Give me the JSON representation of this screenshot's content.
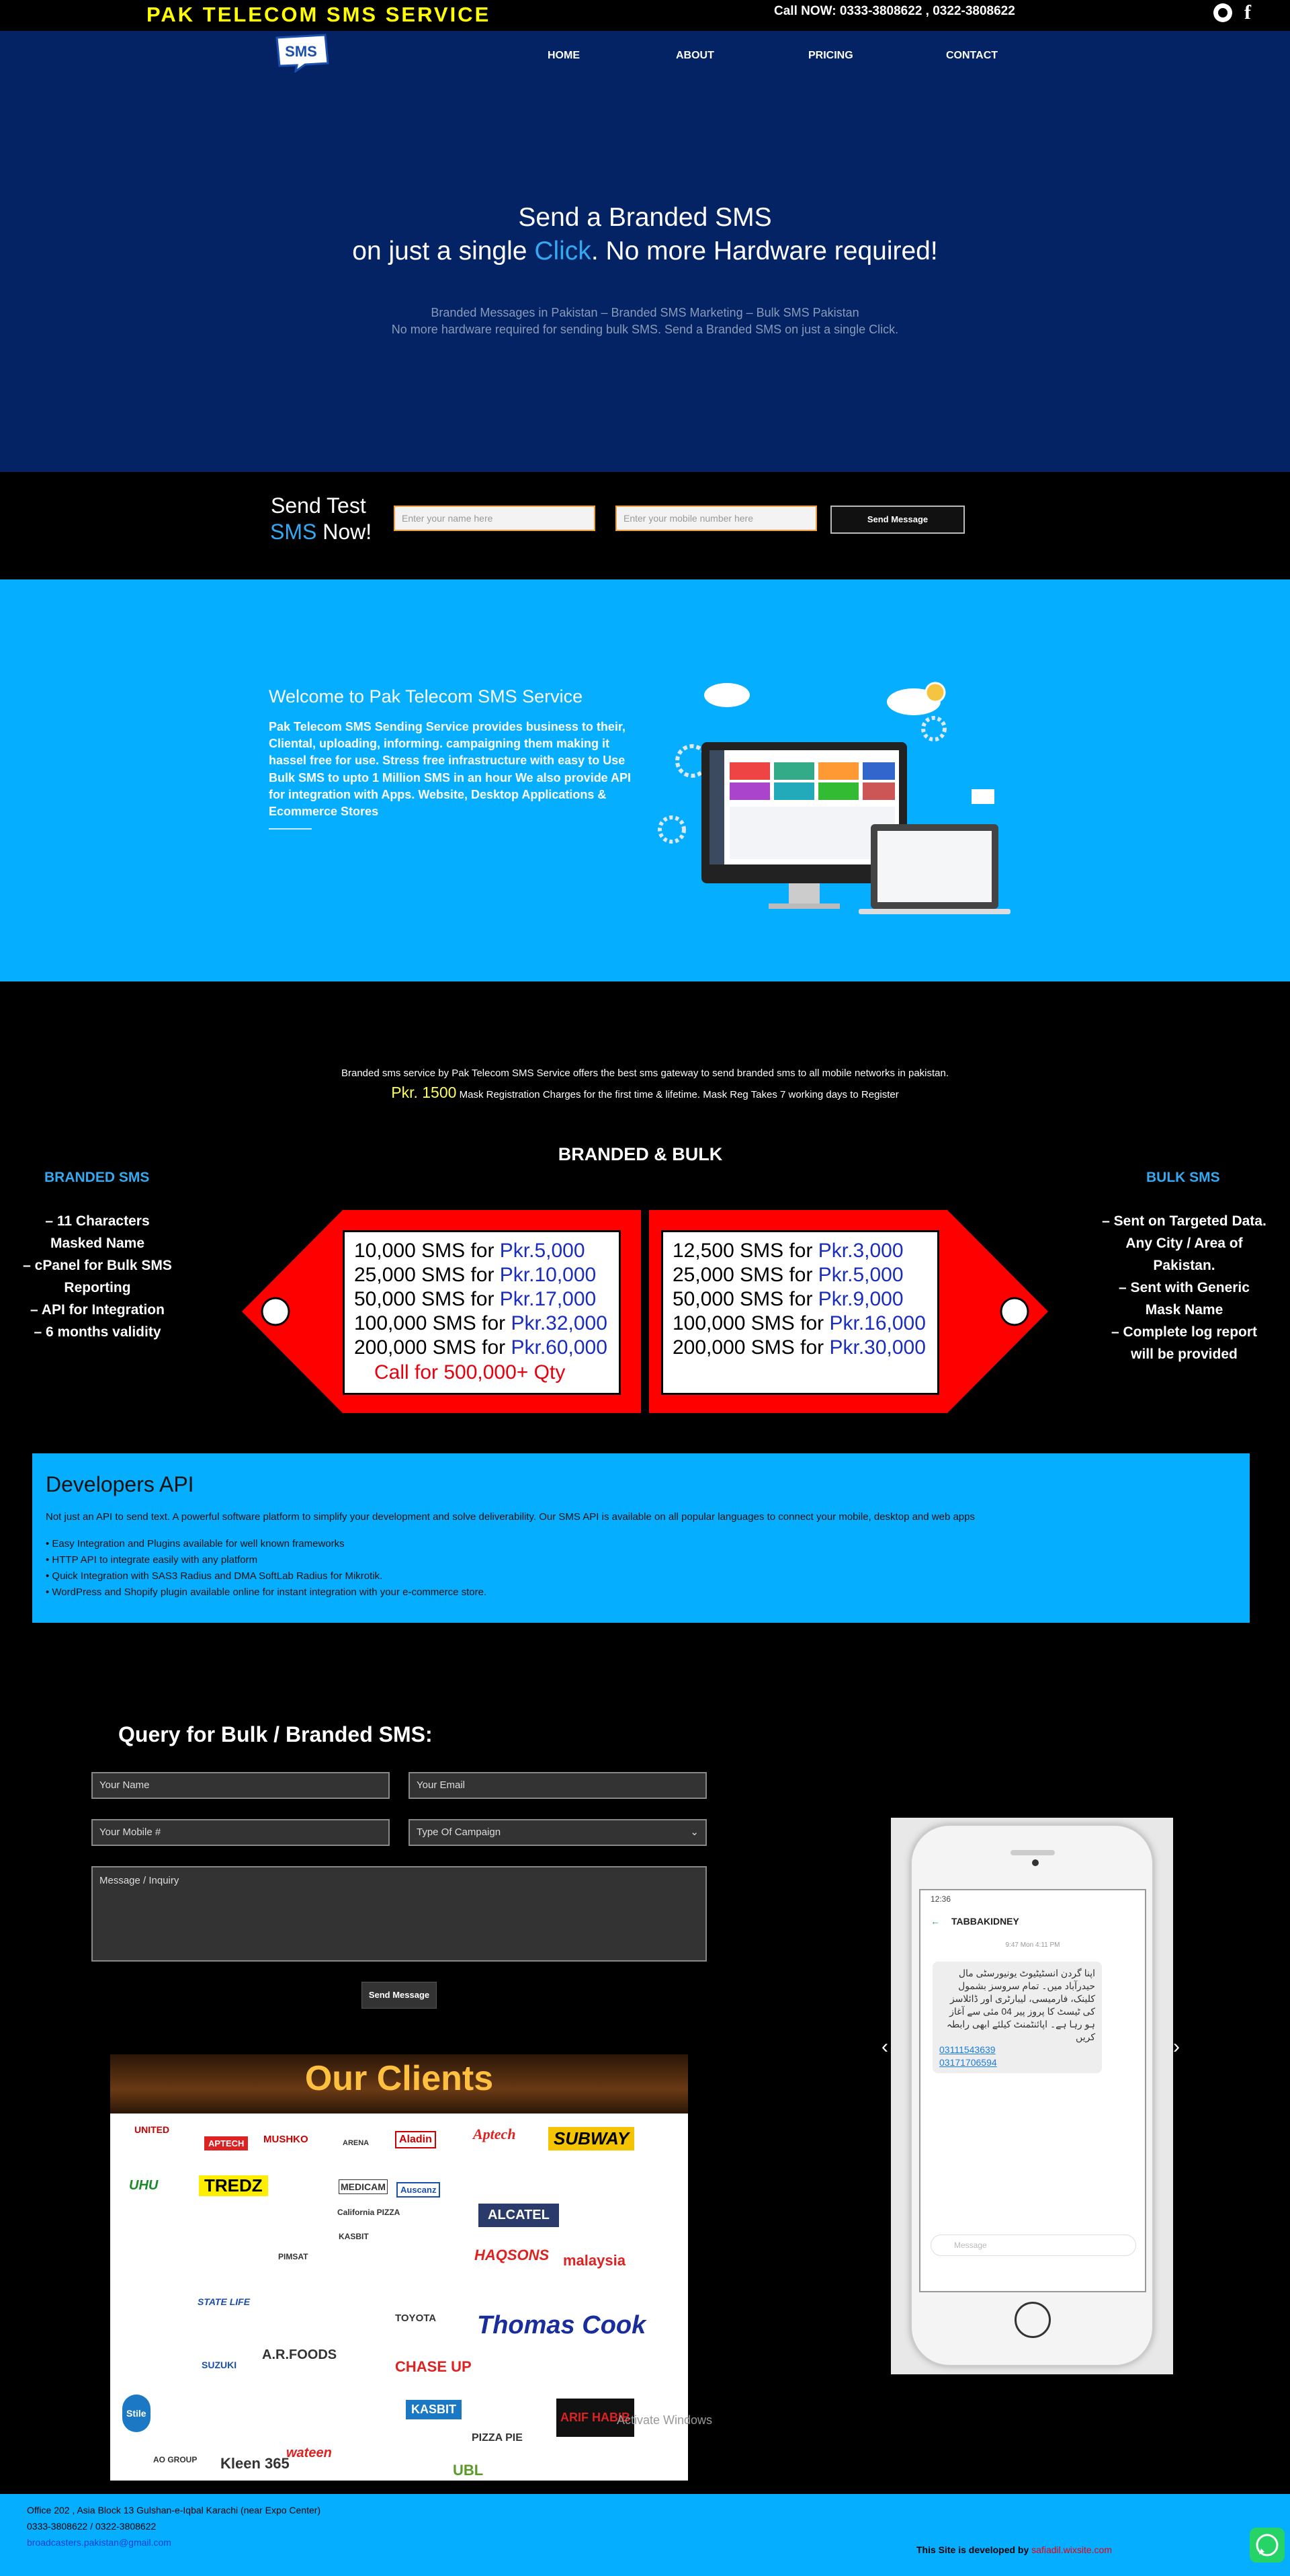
{
  "topbar": {
    "brand": "PAK TELECOM SMS SERVICE",
    "call": "Call NOW: 0333-3808622 , 0322-3808622",
    "fb_glyph": "f"
  },
  "nav": {
    "logo_text": "SMS",
    "items": [
      "HOME",
      "ABOUT",
      "PRICING",
      "CONTACT"
    ]
  },
  "hero": {
    "line1": "Send a Branded SMS",
    "line2_a": "on just a single ",
    "line2_click": "Click",
    "line2_b": ". No more Hardware required!",
    "sub1": "Branded Messages in Pakistan – Branded SMS Marketing – Bulk SMS Pakistan",
    "sub2": "No more hardware required for sending bulk SMS. Send a Branded SMS on just a single Click."
  },
  "sendtest": {
    "title_a": "Send Test",
    "title_sms": "SMS",
    "title_b": " Now!",
    "name_placeholder": "Enter your name here",
    "mobile_placeholder": "Enter your mobile number here",
    "button": "Send Message"
  },
  "welcome": {
    "title": "Welcome to Pak Telecom SMS Service",
    "body": "Pak Telecom SMS Sending Service provides business to their, Cliental, uploading, informing. campaigning them making it hassel free for use. Stress free infrastructure with easy to Use Bulk SMS to upto 1 Million SMS in an hour We also provide API for integration with Apps. Website, Desktop Applications & Ecommerce Stores"
  },
  "pricing": {
    "desc": "Branded sms service by Pak Telecom SMS Service offers the best sms gateway to send branded sms to all mobile networks in pakistan.",
    "mask_price": "Pkr. 1500",
    "mask_text": " Mask Registration Charges for the first time & lifetime. Mask Reg Takes 7 working days to Register",
    "heading": "BRANDED & BULK",
    "branded_title": "BRANDED SMS",
    "branded_features": [
      "– 11 Characters Masked Name",
      "– cPanel for Bulk SMS Reporting",
      "– API for Integration",
      "– 6 months validity"
    ],
    "bulk_title": "BULK SMS",
    "bulk_features": [
      "– Sent on Targeted Data. Any City / Area of Pakistan.",
      "– Sent with Generic Mask Name",
      "– Complete log report will be provided"
    ],
    "branded_rates": [
      {
        "qty": "10,000 SMS for ",
        "price": "Pkr.5,000"
      },
      {
        "qty": "25,000 SMS for ",
        "price": "Pkr.10,000"
      },
      {
        "qty": "50,000 SMS for ",
        "price": "Pkr.17,000"
      },
      {
        "qty": "100,000 SMS for ",
        "price": "Pkr.32,000"
      },
      {
        "qty": "200,000 SMS for ",
        "price": "Pkr.60,000"
      }
    ],
    "branded_call": "Call for 500,000+ Qty",
    "bulk_rates": [
      {
        "qty": "12,500 SMS for ",
        "price": "Pkr.3,000"
      },
      {
        "qty": "25,000 SMS for ",
        "price": "Pkr.5,000"
      },
      {
        "qty": "50,000 SMS for ",
        "price": "Pkr.9,000"
      },
      {
        "qty": "100,000 SMS for ",
        "price": "Pkr.16,000"
      },
      {
        "qty": "200,000 SMS for ",
        "price": "Pkr.30,000"
      }
    ]
  },
  "devapi": {
    "title": "Developers API",
    "desc": "Not just an API to send text. A powerful software platform to simplify your development and solve deliverability. Our SMS API is available on all popular languages to connect your mobile, desktop and web apps",
    "items": [
      "• Easy Integration and Plugins available for well known frameworks",
      "• HTTP API to integrate easily with any platform",
      "• Quick Integration with SAS3 Radius and DMA SoftLab Radius for Mikrotik.",
      "• WordPress and Shopify plugin available online for instant integration with your e-commerce store."
    ]
  },
  "query": {
    "title": "Query for Bulk / Branded SMS:",
    "name": "Your Name",
    "email": "Your Email",
    "mobile": "Your Mobile #",
    "type": "Type Of Campaign",
    "message": "Message / Inquiry",
    "button": "Send Message"
  },
  "clients": {
    "title": "Our Clients",
    "logos": [
      "UNITED",
      "APTECH",
      "MUSHKO",
      "ARENA",
      "Aladin",
      "Aptech",
      "SUBWAY",
      "UHU",
      "TREDZ",
      "MEDICAM",
      "Auscanz",
      "ALCATEL",
      "KASBIT",
      "PIMSAT",
      "California PIZZA",
      "HAQSONS",
      "malaysia",
      "STATE LIFE",
      "SUZUKI",
      "A.R.FOODS",
      "TOYOTA",
      "CHASE UP",
      "Thomas Cook",
      "Stile",
      "KASBIT",
      "PIZZA PIE",
      "ARIF HABIB",
      "AO GROUP",
      "Kleen 365",
      "wateen",
      "UBL"
    ]
  },
  "phone": {
    "status": "12:36",
    "contact": "TABBAKIDNEY",
    "date": "9:47 Mon 4:11 PM",
    "message": "اپنا گردن انسٹیٹیوٹ یونیورسٹی مال حیدرآباد میں۔ تمام سروسز بشمول کلینک، فارمیسی، لیبارٹری اور ڈائلاسز کی ٹیسٹ کا پروز پیر 04 مئی سے آغاز ہو رہا ہے۔ اپائنٹمنٹ کیلئے ابھی رابطہ کریں",
    "num1": "03111543639",
    "num2": "03171706594",
    "input_placeholder": "Message"
  },
  "watermark": "Activate Windows",
  "footer": {
    "address": "Office 202 , Asia Block 13 Gulshan-e-Iqbal Karachi (near Expo Center)",
    "phones": "0333-3808622 / 0322-3808622",
    "email": "broadcasters.pakistan@gmail.com",
    "credit_label": "This Site is developed by ",
    "credit_link": "safiadil.wixsite.com"
  }
}
